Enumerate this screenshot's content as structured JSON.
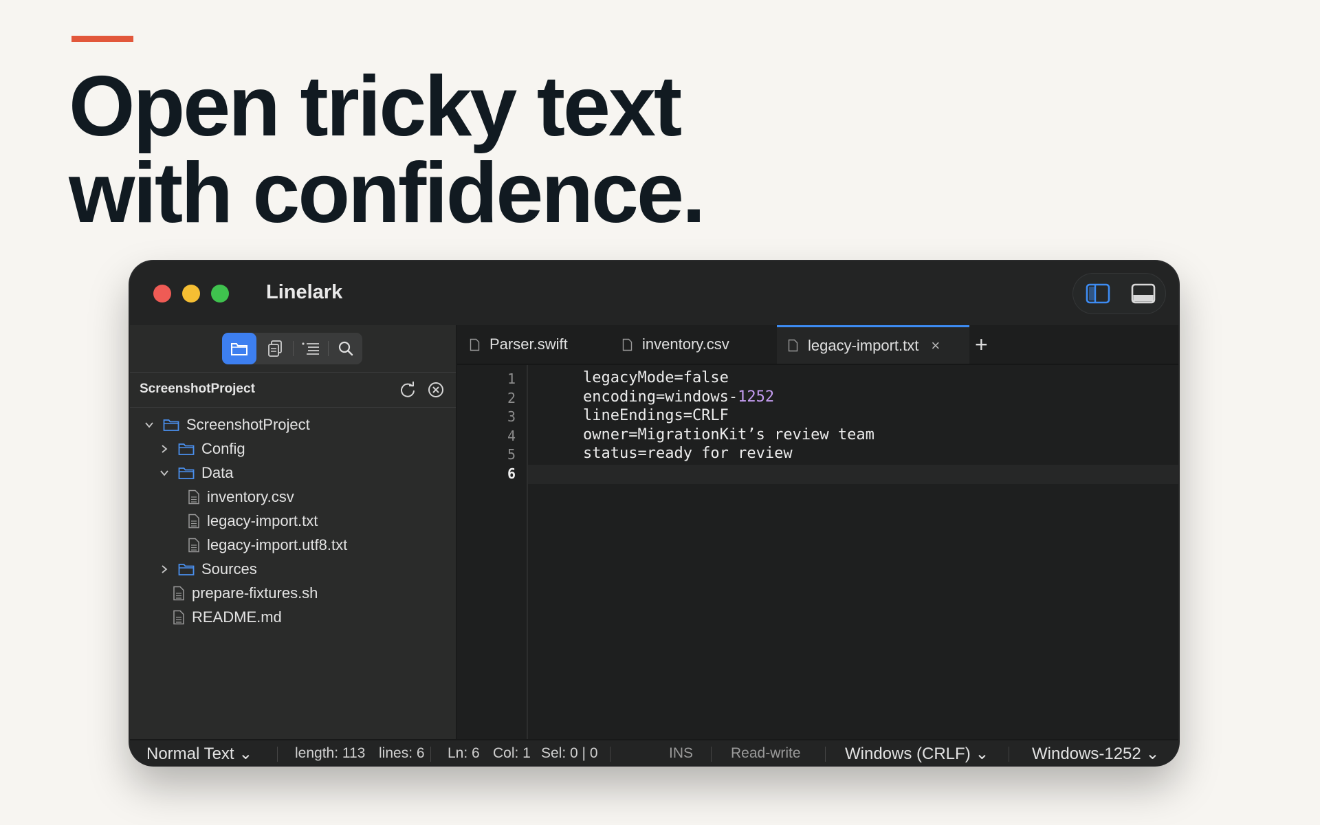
{
  "headline": {
    "line1": "Open tricky text",
    "line2": "with confidence."
  },
  "app": {
    "title": "Linelark"
  },
  "sidebar": {
    "project_title": "ScreenshotProject",
    "tree": [
      {
        "label": "ScreenshotProject",
        "type": "folder",
        "expanded": true,
        "depth": 0
      },
      {
        "label": "Config",
        "type": "folder",
        "expanded": false,
        "depth": 1
      },
      {
        "label": "Data",
        "type": "folder",
        "expanded": true,
        "depth": 1
      },
      {
        "label": "inventory.csv",
        "type": "file",
        "depth": 2
      },
      {
        "label": "legacy-import.txt",
        "type": "file",
        "depth": 2
      },
      {
        "label": "legacy-import.utf8.txt",
        "type": "file",
        "depth": 2
      },
      {
        "label": "Sources",
        "type": "folder",
        "expanded": false,
        "depth": 1
      },
      {
        "label": "prepare-fixtures.sh",
        "type": "file",
        "depth": 1
      },
      {
        "label": "README.md",
        "type": "file",
        "depth": 1
      }
    ]
  },
  "tabs": [
    {
      "label": "Parser.swift",
      "active": false
    },
    {
      "label": "inventory.csv",
      "active": false
    },
    {
      "label": "legacy-import.txt",
      "active": true
    }
  ],
  "tab_add_label": "+",
  "tab_close_label": "×",
  "editor": {
    "line_numbers": [
      "1",
      "2",
      "3",
      "4",
      "5",
      "6"
    ],
    "current_line": 6,
    "lines": [
      {
        "pre": "legacyMode=false",
        "num": "",
        "post": ""
      },
      {
        "pre": "encoding=windows-",
        "num": "1252",
        "post": ""
      },
      {
        "pre": "lineEndings=CRLF",
        "num": "",
        "post": ""
      },
      {
        "pre": "owner=MigrationKit’s review team",
        "num": "",
        "post": ""
      },
      {
        "pre": "status=ready for review",
        "num": "",
        "post": ""
      },
      {
        "pre": "",
        "num": "",
        "post": ""
      }
    ]
  },
  "status": {
    "syntax": "Normal Text",
    "length": "length: 113",
    "lines": "lines: 6",
    "ln": "Ln: 6",
    "col": "Col: 1",
    "sel": "Sel: 0 | 0",
    "mode": "INS",
    "access": "Read-write",
    "line_endings": "Windows (CRLF)",
    "encoding": "Windows-1252"
  },
  "colors": {
    "accent": "#e2573b",
    "selection_blue": "#3d7ff0",
    "number_literal": "#c49cf0"
  }
}
